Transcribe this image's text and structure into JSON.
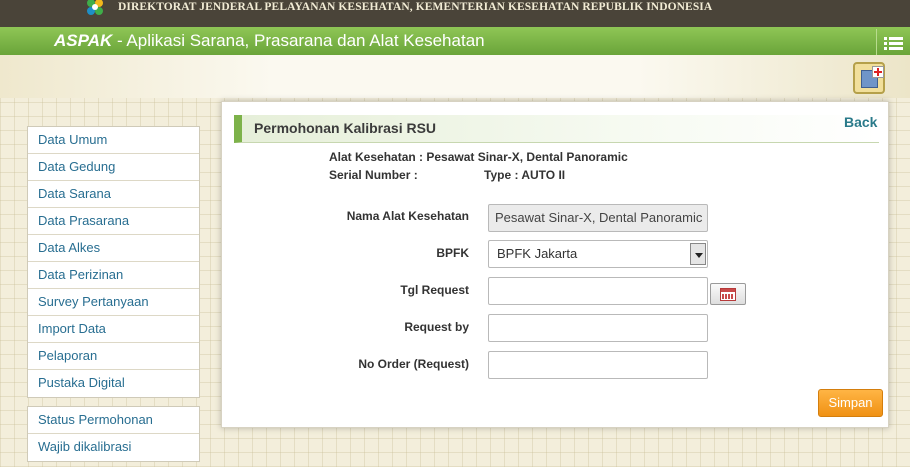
{
  "topbar": {
    "organization": "DIREKTORAT JENDERAL PELAYANAN KESEHATAN, KEMENTERIAN KESEHATAN REPUBLIK INDONESIA"
  },
  "header": {
    "app_name": "ASPAK",
    "app_subtitle": " - Aplikasi Sarana, Prasarana dan Alat Kesehatan"
  },
  "sidebar": {
    "items": [
      {
        "label": "Data Umum"
      },
      {
        "label": "Data Gedung"
      },
      {
        "label": "Data Sarana"
      },
      {
        "label": "Data Prasarana"
      },
      {
        "label": "Data Alkes"
      },
      {
        "label": "Data Perizinan"
      },
      {
        "label": "Survey Pertanyaan"
      },
      {
        "label": "Import Data"
      },
      {
        "label": "Pelaporan"
      },
      {
        "label": "Pustaka Digital"
      }
    ],
    "items2": [
      {
        "label": "Status Permohonan"
      },
      {
        "label": "Wajib dikalibrasi"
      }
    ]
  },
  "panel": {
    "title": "Permohonan Kalibrasi RSU",
    "back_label": "Back",
    "info_alat": "Alat Kesehatan : Pesawat Sinar-X, Dental Panoramic",
    "info_serial": "Serial Number :",
    "info_type": "Type : AUTO II"
  },
  "form": {
    "nama_alat_label": "Nama Alat Kesehatan",
    "nama_alat_value": "Pesawat Sinar-X, Dental Panoramic",
    "bpfk_label": "BPFK",
    "bpfk_value": "BPFK Jakarta",
    "tgl_label": "Tgl Request",
    "tgl_value": "",
    "request_by_label": "Request by",
    "request_by_value": "",
    "no_order_label": "No Order (Request)",
    "no_order_value": "",
    "save_label": "Simpan"
  },
  "colors": {
    "top_bar": "#4a4439",
    "green_bar": "#7cb548",
    "link": "#286e91",
    "save_button": "#f5a12a"
  }
}
